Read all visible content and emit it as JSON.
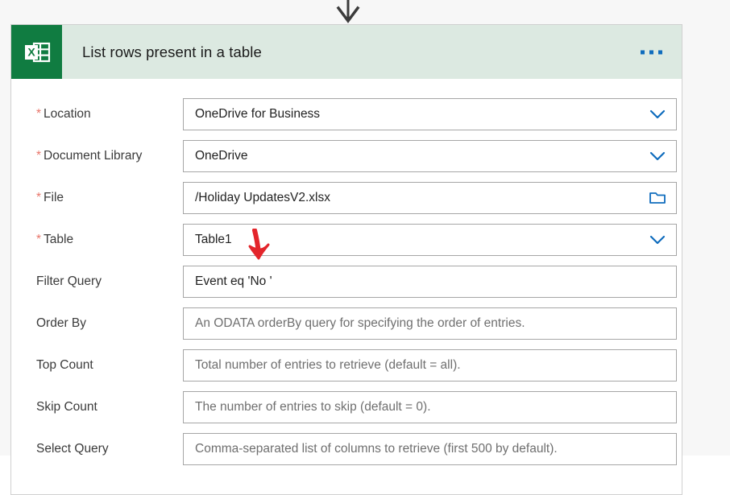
{
  "card": {
    "title": "List rows present in a table",
    "app_icon": "excel-icon",
    "overflow_menu": "ellipsis-icon",
    "header_color": "#dce9e1",
    "icon_color": "#107c41",
    "accent_color": "#0f6cbd",
    "required_marker": "*",
    "fields": [
      {
        "label": "Location",
        "required": true,
        "value": "OneDrive for Business",
        "is_placeholder": false,
        "affordance": "chevron-down-icon"
      },
      {
        "label": "Document Library",
        "required": true,
        "value": "OneDrive",
        "is_placeholder": false,
        "affordance": "chevron-down-icon"
      },
      {
        "label": "File",
        "required": true,
        "value": "/Holiday UpdatesV2.xlsx",
        "is_placeholder": false,
        "affordance": "folder-icon"
      },
      {
        "label": "Table",
        "required": true,
        "value": "Table1",
        "is_placeholder": false,
        "affordance": "chevron-down-icon"
      },
      {
        "label": "Filter Query",
        "required": false,
        "value": "Event eq 'No '",
        "is_placeholder": false,
        "affordance": "none"
      },
      {
        "label": "Order By",
        "required": false,
        "value": "An ODATA orderBy query for specifying the order of entries.",
        "is_placeholder": true,
        "affordance": "none"
      },
      {
        "label": "Top Count",
        "required": false,
        "value": "Total number of entries to retrieve (default = all).",
        "is_placeholder": true,
        "affordance": "none"
      },
      {
        "label": "Skip Count",
        "required": false,
        "value": "The number of entries to skip (default = 0).",
        "is_placeholder": true,
        "affordance": "none"
      },
      {
        "label": "Select Query",
        "required": false,
        "value": "Comma-separated list of columns to retrieve (first 500 by default).",
        "is_placeholder": true,
        "affordance": "none"
      }
    ]
  },
  "connector": {
    "icon": "flow-connector-arrow-down",
    "color": "#3b3b3b",
    "node_color": "#0f6cbd"
  },
  "annotation": {
    "icon": "red-arrow-down",
    "color": "#e3252b",
    "points_at": "Filter Query"
  }
}
